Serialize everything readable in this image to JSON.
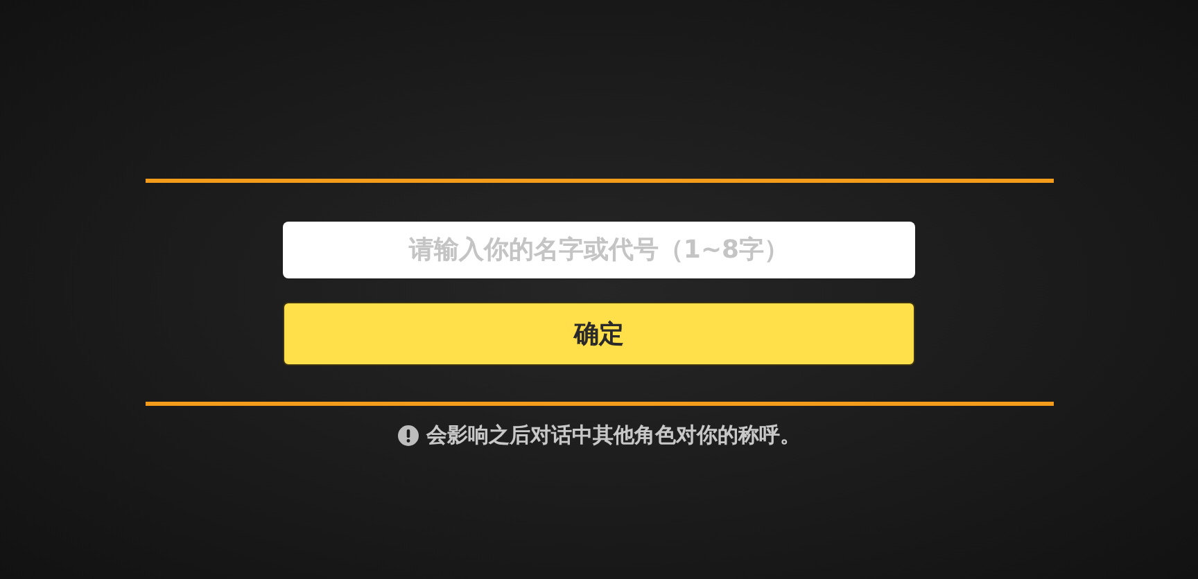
{
  "name_field": {
    "placeholder": "请输入你的名字或代号（1~8字）"
  },
  "confirm_button": {
    "label": "确定"
  },
  "note": {
    "text": "会影响之后对话中其他角色对你的称呼。"
  }
}
